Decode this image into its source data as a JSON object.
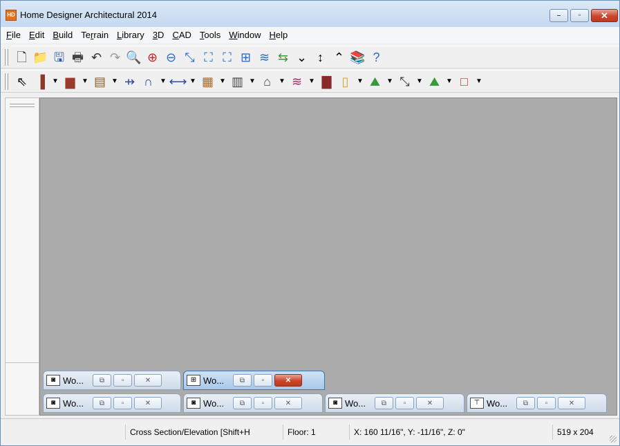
{
  "window": {
    "title": "Home Designer Architectural 2014",
    "icon": "HD",
    "controls": {
      "minimize": "–",
      "maximize": "▫",
      "close": "✕"
    }
  },
  "menu": [
    {
      "pre": "",
      "u": "F",
      "post": "ile"
    },
    {
      "pre": "",
      "u": "E",
      "post": "dit"
    },
    {
      "pre": "",
      "u": "B",
      "post": "uild"
    },
    {
      "pre": "Te",
      "u": "r",
      "post": "rain"
    },
    {
      "pre": "",
      "u": "L",
      "post": "ibrary"
    },
    {
      "pre": "",
      "u": "3",
      "post": "D"
    },
    {
      "pre": "",
      "u": "C",
      "post": "AD"
    },
    {
      "pre": "",
      "u": "T",
      "post": "ools"
    },
    {
      "pre": "",
      "u": "W",
      "post": "indow"
    },
    {
      "pre": "",
      "u": "H",
      "post": "elp"
    }
  ],
  "toolbar1": [
    {
      "icon": "new-file-icon",
      "glyph": "🗋",
      "color": "#333333"
    },
    {
      "icon": "open-folder-icon",
      "glyph": "📁",
      "color": "#e6b83a"
    },
    {
      "icon": "save-icon",
      "glyph": "🖫",
      "color": "#2a5aa0"
    },
    {
      "icon": "print-icon",
      "glyph": "🖶",
      "color": "#444444"
    },
    {
      "icon": "undo-icon",
      "glyph": "↶",
      "color": "#333333"
    },
    {
      "icon": "redo-icon",
      "glyph": "↷",
      "color": "#999999"
    },
    {
      "icon": "zoom-icon",
      "glyph": "🔍",
      "color": "#2a6cc4"
    },
    {
      "icon": "zoom-in-icon",
      "glyph": "⊕",
      "color": "#c0282d"
    },
    {
      "icon": "zoom-out-icon",
      "glyph": "⊖",
      "color": "#2a6cc4"
    },
    {
      "icon": "undo-zoom-icon",
      "glyph": "⤡",
      "color": "#2a6cc4"
    },
    {
      "icon": "fill-window-icon",
      "glyph": "⛶",
      "color": "#2a6cc4"
    },
    {
      "icon": "fill-window-building-icon",
      "glyph": "⛶",
      "color": "#2a6cc4"
    },
    {
      "icon": "pan-icon",
      "glyph": "⊞",
      "color": "#2a6cc4"
    },
    {
      "icon": "layers-icon",
      "glyph": "≋",
      "color": "#2a6cc4"
    },
    {
      "icon": "swap-floors-icon",
      "glyph": "⇆",
      "color": "#3a9a3a"
    },
    {
      "icon": "down-floor-icon",
      "glyph": "⌄",
      "color": "#000000"
    },
    {
      "icon": "reference-floor-icon",
      "glyph": "↕",
      "color": "#000000"
    },
    {
      "icon": "up-floor-icon",
      "glyph": "⌃",
      "color": "#000000"
    },
    {
      "icon": "library-icon",
      "glyph": "📚",
      "color": "#8a6a2a"
    },
    {
      "icon": "help-icon",
      "glyph": "?",
      "color": "#2a6cc4"
    }
  ],
  "toolbar2": [
    {
      "icon": "select-pointer-icon",
      "glyph": "⇖",
      "color": "#000000",
      "dd": false
    },
    {
      "icon": "wall-icon",
      "glyph": "▐",
      "color": "#8b3a2a",
      "dd": true
    },
    {
      "icon": "cabinet-icon",
      "glyph": "▆",
      "color": "#9b3a2a",
      "dd": true
    },
    {
      "icon": "stairs-icon",
      "glyph": "▤",
      "color": "#8b5a2a",
      "dd": true
    },
    {
      "icon": "dimension-icon",
      "glyph": "⇸",
      "color": "#2a4aa0",
      "dd": false
    },
    {
      "icon": "arch-icon",
      "glyph": "∩",
      "color": "#2a4aa0",
      "dd": true
    },
    {
      "icon": "line-icon",
      "glyph": "⟷",
      "color": "#2a4aa0",
      "dd": true
    },
    {
      "icon": "window-icon",
      "glyph": "▦",
      "color": "#b06a2a",
      "dd": true
    },
    {
      "icon": "window-double-icon",
      "glyph": "▥",
      "color": "#444444",
      "dd": true
    },
    {
      "icon": "house-icon",
      "glyph": "⌂",
      "color": "#444444",
      "dd": true
    },
    {
      "icon": "roof-icon",
      "glyph": "≋",
      "color": "#a02a6a",
      "dd": true
    },
    {
      "icon": "fireplace-icon",
      "glyph": "▇",
      "color": "#8b2a2a",
      "dd": false
    },
    {
      "icon": "elevator-icon",
      "glyph": "▯",
      "color": "#d0a020",
      "dd": true
    },
    {
      "icon": "terrain-icon",
      "glyph": "⛰",
      "color": "#3a9a3a",
      "dd": true
    },
    {
      "icon": "path-icon",
      "glyph": "⤡",
      "color": "#333333",
      "dd": true
    },
    {
      "icon": "landscape-icon",
      "glyph": "⛰",
      "color": "#3a9a3a",
      "dd": true
    },
    {
      "icon": "box-icon",
      "glyph": "□",
      "color": "#c0282d",
      "dd": true
    }
  ],
  "minimized_windows": [
    {
      "label": "Wo...",
      "icon": "camera-view-icon",
      "glyph": "◙",
      "active": false
    },
    {
      "label": "Wo...",
      "icon": "plan-view-icon",
      "glyph": "⊞",
      "active": true
    },
    {
      "label": "Wo...",
      "icon": "camera-view-icon",
      "glyph": "◙",
      "active": false
    },
    {
      "label": "Wo...",
      "icon": "camera-view-icon",
      "glyph": "◙",
      "active": false
    },
    {
      "label": "Wo...",
      "icon": "camera-view-icon",
      "glyph": "◙",
      "active": false
    },
    {
      "label": "Wo...",
      "icon": "elevation-view-icon",
      "glyph": "⊤",
      "active": false
    }
  ],
  "mini_controls": {
    "restore": "⧉",
    "maximize": "▫",
    "close": "✕"
  },
  "status": {
    "mode": "Cross Section/Elevation [Shift+H",
    "floor": "Floor: 1",
    "coords": "X: 160 11/16\", Y: -11/16\", Z: 0\"",
    "size": "519 x 204"
  }
}
